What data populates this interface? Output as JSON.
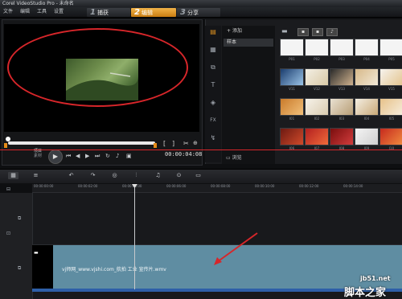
{
  "app": {
    "title": "Corel VideoStudio Pro - 未命名"
  },
  "menu": {
    "file": "文件",
    "edit": "编辑",
    "tools": "工具",
    "settings": "设置"
  },
  "steps": [
    {
      "num": "1",
      "label": "捕获"
    },
    {
      "num": "2",
      "label": "编辑"
    },
    {
      "num": "3",
      "label": "分享"
    }
  ],
  "preview": {
    "mark_in": "[",
    "mark_out": "]",
    "cut": "✂",
    "project_label": "项目",
    "clip_label": "素材",
    "timecode": "00:00:04:08"
  },
  "library": {
    "add_label": "添加",
    "folder_item": "样本",
    "browse_label": "浏览",
    "thumbs": [
      "P01",
      "P02",
      "P03",
      "P04",
      "P05",
      "V11",
      "V12",
      "V13",
      "V14",
      "V15",
      "I01",
      "I02",
      "I03",
      "I04",
      "I05",
      "I06",
      "I07",
      "I08",
      "I09",
      "I10"
    ]
  },
  "timeline": {
    "ruler_ticks": [
      "00:00:00:00",
      "00:00:02:00",
      "00:00:04:00",
      "00:00:06:00",
      "00:00:08:00",
      "00:00:10:00",
      "00:00:12:00",
      "00:00:14:00"
    ],
    "clip_name": "vj师网_www.vjshi.com_航拍 工业 宣传片.wmv"
  },
  "watermark": {
    "url": "jb51.net",
    "text": "脚本之家"
  },
  "colors": {
    "accent": "#e0921f",
    "highlight": "#d7262a",
    "clip": "#5f8da2"
  }
}
